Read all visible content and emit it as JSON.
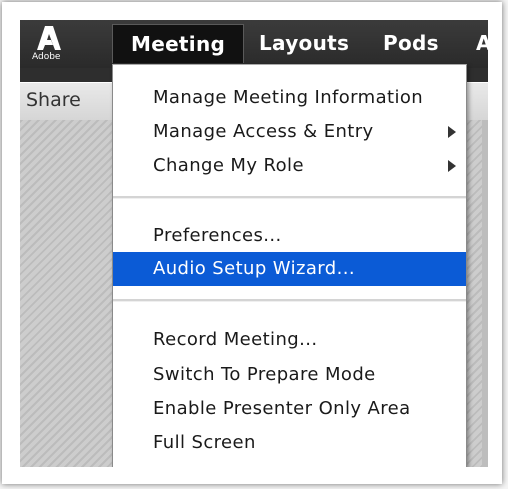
{
  "menubar": {
    "logo_text": "Adobe",
    "items": [
      {
        "label": "Meeting",
        "active": true
      },
      {
        "label": "Layouts",
        "active": false
      },
      {
        "label": "Pods",
        "active": false
      },
      {
        "label": "A",
        "active": false
      }
    ]
  },
  "sharebar": {
    "label": "Share"
  },
  "dropdown": {
    "group1": [
      {
        "label": "Manage Meeting Information",
        "submenu": false
      },
      {
        "label": "Manage Access & Entry",
        "submenu": true
      },
      {
        "label": "Change My Role",
        "submenu": true
      }
    ],
    "group2": [
      {
        "label": "Preferences...",
        "highlighted": false
      },
      {
        "label": "Audio Setup Wizard...",
        "highlighted": true
      }
    ],
    "group3": [
      {
        "label": "Record Meeting..."
      },
      {
        "label": "Switch To Prepare Mode"
      },
      {
        "label": "Enable Presenter Only Area"
      },
      {
        "label": "Full Screen"
      }
    ]
  },
  "colors": {
    "highlight": "#0b5bd6",
    "menubar": "#2e2e2e"
  }
}
